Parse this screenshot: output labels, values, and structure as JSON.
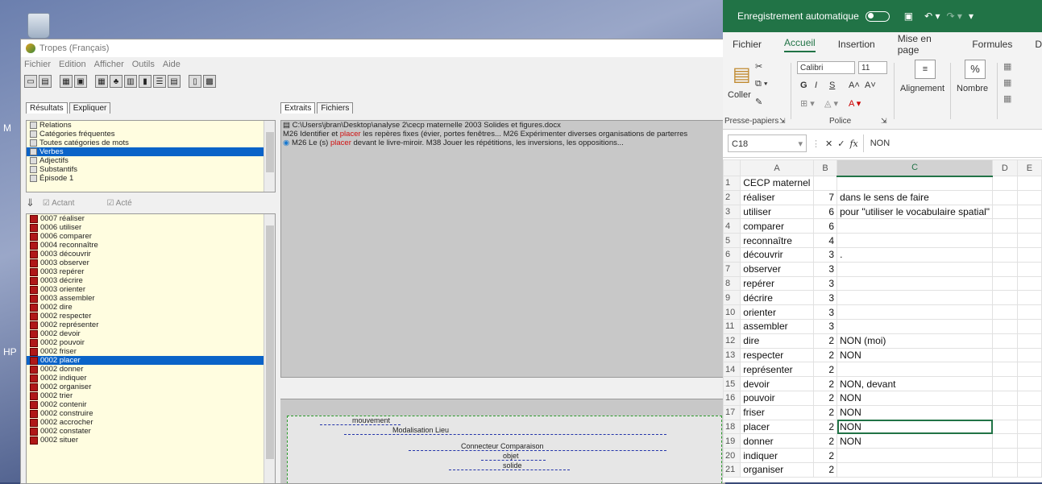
{
  "desktop": {
    "side_label_1": "M",
    "side_label_2": "HP"
  },
  "tropes": {
    "title": "Tropes (Français)",
    "menu": [
      "Fichier",
      "Edition",
      "Afficher",
      "Outils",
      "Aide"
    ],
    "left_tabs": [
      "Résultats",
      "Expliquer"
    ],
    "right_tabs": [
      "Extraits",
      "Fichiers"
    ],
    "top_list": [
      {
        "label": "Relations"
      },
      {
        "label": "Catégories fréquentes"
      },
      {
        "label": "Toutes catégories de mots"
      },
      {
        "label": "Verbes"
      },
      {
        "label": "Adjectifs"
      },
      {
        "label": "Substantifs"
      },
      {
        "label": "Épisode 1"
      }
    ],
    "filter": {
      "actant": "Actant",
      "acte": "Acté"
    },
    "verbs": [
      "0007 réaliser",
      "0006 utiliser",
      "0006 comparer",
      "0004 reconnaître",
      "0003 découvrir",
      "0003 observer",
      "0003 repérer",
      "0003 décrire",
      "0003 orienter",
      "0003 assembler",
      "0002 dire",
      "0002 respecter",
      "0002 représenter",
      "0002 devoir",
      "0002 pouvoir",
      "0002 friser",
      "0002 placer",
      "0002 donner",
      "0002 indiquer",
      "0002 organiser",
      "0002 trier",
      "0002 contenir",
      "0002 construire",
      "0002 accrocher",
      "0002 constater",
      "0002 situer"
    ],
    "extracts": {
      "path": "C:\\Users\\jbran\\Desktop\\analyse 2\\cecp maternelle 2003 Solides et figures.docx",
      "line1_a": "M26 Identifier et ",
      "line1_hl": "placer",
      "line1_b": " les repères fixes (évier, portes fenêtres... M26 Expérimenter diverses organisations de parterres",
      "line2_a": "M26 Le (s) ",
      "line2_hl": "placer",
      "line2_b": " devant le livre-miroir. M38 Jouer les répétitions, les inversions, les oppositions..."
    },
    "graph": {
      "labels": [
        "mouvement",
        "Modalisation Lieu",
        "Connecteur Comparaison",
        "objet",
        "solide"
      ]
    }
  },
  "excel": {
    "autosave_label": "Enregistrement automatique",
    "tabs": [
      "Fichier",
      "Accueil",
      "Insertion",
      "Mise en page",
      "Formules",
      "D"
    ],
    "ribbon": {
      "paste": "Coller",
      "font_name": "Calibri",
      "font_size": "11",
      "bold": "G",
      "italic": "I",
      "underline": "S",
      "grow": "A˄",
      "shrink": "A˅",
      "alignment": "Alignement",
      "number": "Nombre",
      "number_symbol": "%",
      "group_clipboard": "Presse-papiers",
      "group_font": "Police"
    },
    "name_box": "C18",
    "fx": "fx",
    "formula_value": "NON",
    "columns": [
      "A",
      "B",
      "C",
      "D",
      "E"
    ],
    "rows": [
      {
        "n": "1",
        "a": "CECP maternel",
        "b": "",
        "c": ""
      },
      {
        "n": "2",
        "a": "réaliser",
        "b": "7",
        "c": "dans le sens de faire"
      },
      {
        "n": "3",
        "a": "utiliser",
        "b": "6",
        "c": "pour \"utiliser le vocabulaire spatial\""
      },
      {
        "n": "4",
        "a": "comparer",
        "b": "6",
        "c": ""
      },
      {
        "n": "5",
        "a": "reconnaître",
        "b": "4",
        "c": ""
      },
      {
        "n": "6",
        "a": "découvrir",
        "b": "3",
        "c": "."
      },
      {
        "n": "7",
        "a": "observer",
        "b": "3",
        "c": ""
      },
      {
        "n": "8",
        "a": "repérer",
        "b": "3",
        "c": ""
      },
      {
        "n": "9",
        "a": "décrire",
        "b": "3",
        "c": ""
      },
      {
        "n": "10",
        "a": "orienter",
        "b": "3",
        "c": ""
      },
      {
        "n": "11",
        "a": "assembler",
        "b": "3",
        "c": ""
      },
      {
        "n": "12",
        "a": "dire",
        "b": "2",
        "c": "NON (moi)"
      },
      {
        "n": "13",
        "a": "respecter",
        "b": "2",
        "c": "NON"
      },
      {
        "n": "14",
        "a": "représenter",
        "b": "2",
        "c": ""
      },
      {
        "n": "15",
        "a": "devoir",
        "b": "2",
        "c": "NON, devant"
      },
      {
        "n": "16",
        "a": "pouvoir",
        "b": "2",
        "c": "NON"
      },
      {
        "n": "17",
        "a": "friser",
        "b": "2",
        "c": "NON"
      },
      {
        "n": "18",
        "a": "placer",
        "b": "2",
        "c": "NON"
      },
      {
        "n": "19",
        "a": "donner",
        "b": "2",
        "c": "NON"
      },
      {
        "n": "20",
        "a": "indiquer",
        "b": "2",
        "c": ""
      },
      {
        "n": "21",
        "a": "organiser",
        "b": "2",
        "c": ""
      }
    ]
  }
}
